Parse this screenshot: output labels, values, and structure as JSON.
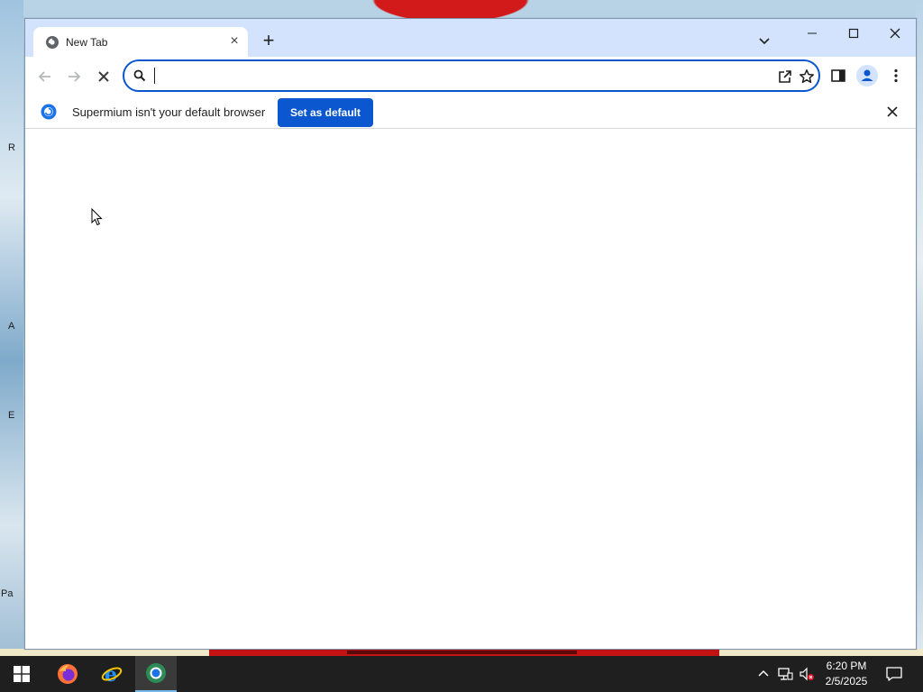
{
  "desktop": {
    "labels": [
      "R",
      "A",
      "E",
      "Pa"
    ]
  },
  "tab": {
    "title": "New Tab",
    "close_symbol": "×",
    "favicon": "supermium-icon"
  },
  "tabstrip": {
    "new_tab_symbol": "+",
    "tab_search": "chevron-down-icon"
  },
  "window_controls": [
    "minimize-icon",
    "maximize-icon",
    "close-icon"
  ],
  "toolbar": {
    "back": "back-arrow-icon",
    "forward": "forward-arrow-icon",
    "stop": "stop-icon",
    "omnibox": {
      "value": "",
      "search_icon": "search-icon",
      "share": "share-icon",
      "bookmark": "star-icon"
    },
    "side_panel": "side-panel-icon",
    "profile": "profile-icon",
    "menu": "kebab-menu-icon"
  },
  "infobar": {
    "message": "Supermium isn't your default browser",
    "button_label": "Set as default",
    "icon": "supermium-icon",
    "close": "close-icon",
    "accent": "#0b57d0"
  },
  "taskbar": {
    "start": "windows-start-icon",
    "apps": [
      {
        "name": "firefox-icon",
        "active": false
      },
      {
        "name": "internet-explorer-icon",
        "active": false
      },
      {
        "name": "supermium-icon",
        "active": true
      }
    ],
    "tray": [
      "chevron-up-icon",
      "network-icon",
      "volume-muted-icon"
    ],
    "time": "6:20 PM",
    "date": "2/5/2025",
    "notifications": "action-center-icon"
  }
}
